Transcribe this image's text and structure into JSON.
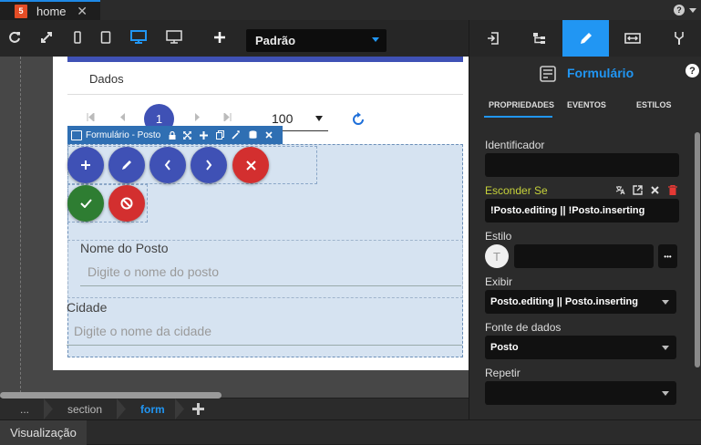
{
  "tabs": {
    "home_label": "home",
    "close_glyph": "✕"
  },
  "toolbar": {
    "icons": [
      "refresh-icon",
      "fullscreen-icon",
      "phone-icon",
      "tablet-icon",
      "desktop-icon",
      "monitor-icon",
      "add-icon"
    ],
    "profile_value": "Padrão"
  },
  "canvas": {
    "tab_label": "Dados",
    "pagination": {
      "current_page": "1",
      "page_size": "100"
    },
    "component_bar_title": "Formulário - Posto",
    "fields": [
      {
        "label": "Nome do Posto",
        "placeholder": "Digite o nome do posto"
      },
      {
        "label": "Cidade",
        "placeholder": "Digite o nome da cidade"
      }
    ]
  },
  "breadcrumb": {
    "items": [
      "...",
      "section",
      "form"
    ],
    "active": "form"
  },
  "status": {
    "visualizacao": "Visualização"
  },
  "panel": {
    "title": "Formulário",
    "help_glyph": "?",
    "subtabs": [
      "PROPRIEDADES",
      "EVENTOS",
      "ESTILOS"
    ],
    "identificador_label": "Identificador",
    "identificador_value": "",
    "esconder_label": "Esconder Se",
    "esconder_value": "!Posto.editing || !Posto.inserting",
    "estilo_label": "Estilo",
    "estilo_avatar": "T",
    "estilo_more": "•••",
    "exibir_label": "Exibir",
    "exibir_value": "Posto.editing || Posto.inserting",
    "fonte_label": "Fonte de dados",
    "fonte_value": "Posto",
    "repetir_label": "Repetir",
    "repetir_value": ""
  },
  "colors": {
    "accent": "#2196f3",
    "esconder_label": "#c6d23a",
    "primary_fab": "#3f51b5",
    "danger_fab": "#d32f2f",
    "success_fab": "#2e7d32"
  }
}
